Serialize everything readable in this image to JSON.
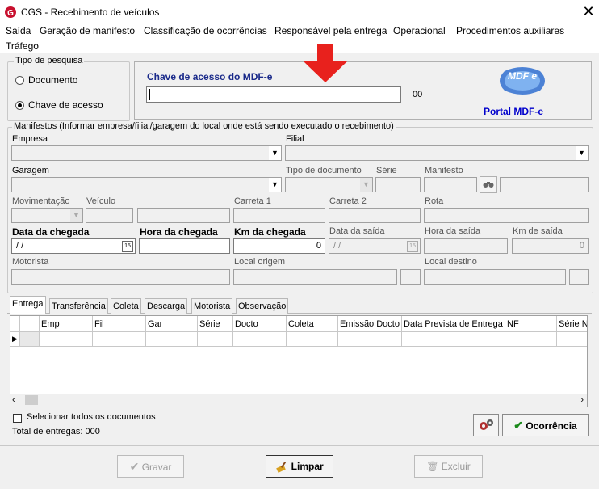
{
  "window": {
    "title": "CGS - Recebimento de veículos",
    "close_glyph": "✕"
  },
  "menu": [
    "Saída",
    "Geração de manifesto",
    "Classificação de ocorrências",
    "Responsável pela entrega",
    "Operacional",
    "Procedimentos auxiliares",
    "Tráfego"
  ],
  "search_type": {
    "legend": "Tipo de pesquisa",
    "options": [
      "Documento",
      "Chave de acesso"
    ],
    "selected": "Chave de acesso"
  },
  "mdfe": {
    "label": "Chave de acesso do MDF-e",
    "value": "",
    "counter": "00",
    "portal_link": "Portal MDF-e",
    "logo_text": "MDF e",
    "annotation_arrow_color": "#e8211d"
  },
  "manifests": {
    "legend": "Manifestos (Informar empresa/filial/garagem do local onde está sendo executado o recebimento)",
    "labels": {
      "empresa": "Empresa",
      "filial": "Filial",
      "garagem": "Garagem",
      "tipo_documento": "Tipo de documento",
      "serie": "Série",
      "manifesto": "Manifesto",
      "movimentacao": "Movimentação",
      "veiculo": "Veículo",
      "carreta1": "Carreta 1",
      "carreta2": "Carreta 2",
      "rota": "Rota",
      "data_chegada": "Data da chegada",
      "hora_chegada": "Hora da chegada",
      "km_chegada": "Km da chegada",
      "data_saida": "Data da saída",
      "hora_saida": "Hora da saída",
      "km_saida": "Km de saída",
      "motorista": "Motorista",
      "local_origem": "Local origem",
      "local_destino": "Local destino"
    },
    "values": {
      "data_chegada": " / /",
      "km_chegada": "0",
      "data_saida": " / /",
      "km_saida": "0",
      "cal": "15"
    }
  },
  "tabs": [
    "Entrega",
    "Transferência",
    "Coleta",
    "Descarga",
    "Motorista",
    "Observação"
  ],
  "active_tab": "Entrega",
  "grid": {
    "columns": [
      "Emp",
      "Fil",
      "Gar",
      "Série",
      "Docto",
      "Coleta",
      "Emissão Docto",
      "Data Prevista de Entrega",
      "NF",
      "Série N"
    ],
    "row_indicator": "▶"
  },
  "footer": {
    "select_all": "Selecionar todos os documentos",
    "total": "Total de entregas: 000",
    "ocorrencia_button": "Ocorrência"
  },
  "actions": {
    "gravar": "Gravar",
    "limpar": "Limpar",
    "excluir": "Excluir"
  },
  "colors": {
    "link": "#0000cc",
    "label_blue": "#1a2a8a",
    "ok_green": "#1a8a1a"
  }
}
